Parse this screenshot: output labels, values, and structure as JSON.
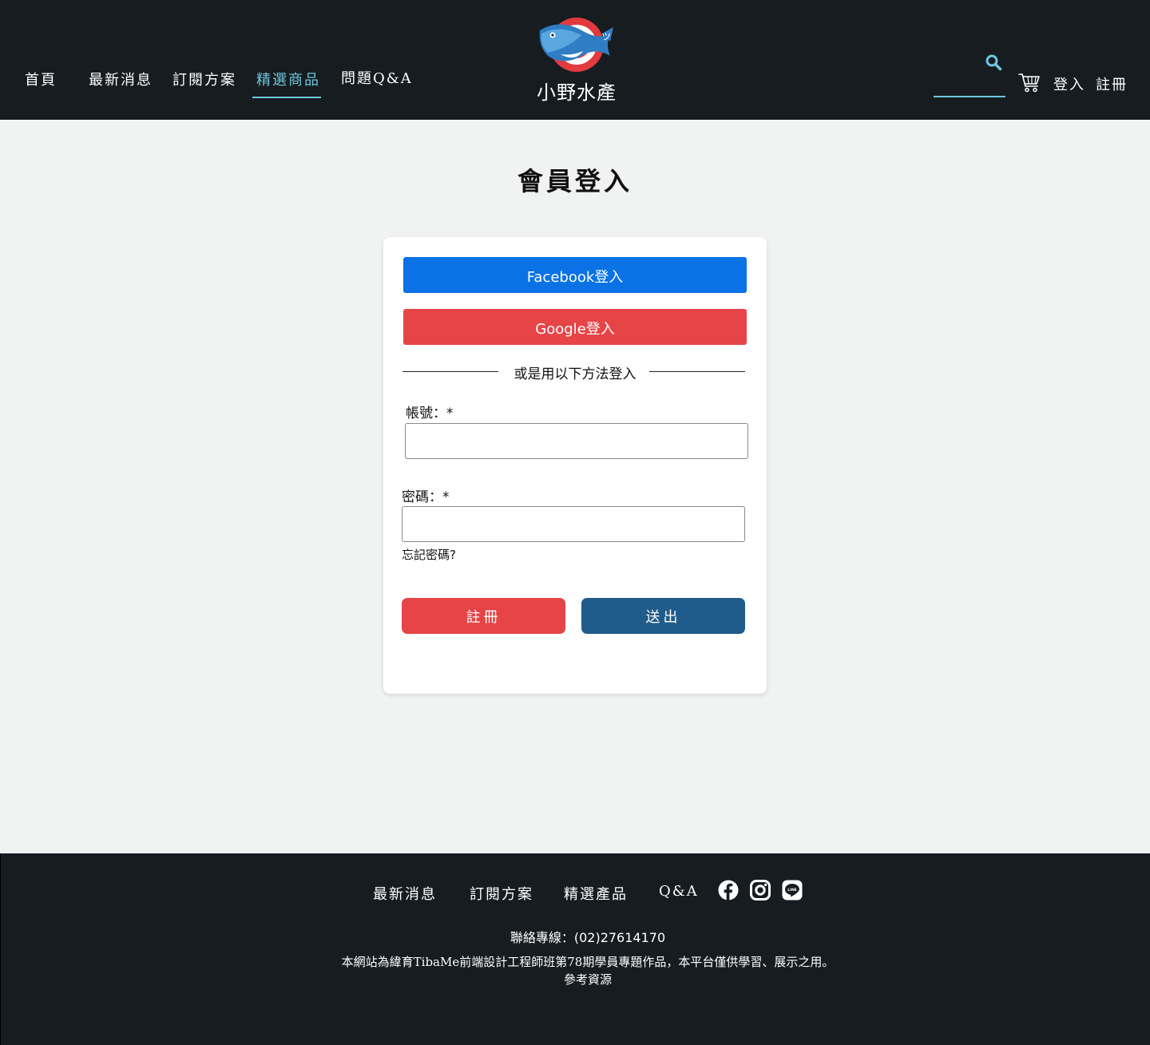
{
  "header": {
    "nav": [
      "首頁",
      "最新消息",
      "訂閱方案",
      "精選商品",
      "問題Q&A"
    ],
    "active_nav": "精選商品",
    "logo_text": "小野水產",
    "search": {
      "value": "",
      "placeholder": ""
    },
    "login_label": "登入",
    "register_label": "註冊",
    "icons": {
      "search": "search-icon",
      "cart": "cart-icon"
    }
  },
  "main": {
    "title": "會員登入",
    "facebook_label": "Facebook登入",
    "google_label": "Google登入",
    "divider_text": "或是用以下方法登入",
    "account_label": "帳號：*",
    "account": {
      "value": "",
      "placeholder": ""
    },
    "password_label": "密碼：*",
    "password": {
      "value": "",
      "placeholder": ""
    },
    "forgot_label": "忘記密碼?",
    "register_button": "註冊",
    "submit_button": "送出"
  },
  "footer": {
    "links": [
      "最新消息",
      "訂閱方案",
      "精選產品",
      "Q&A"
    ],
    "social_icons": [
      "facebook-icon",
      "instagram-icon",
      "line-icon"
    ],
    "contact": "聯絡專線：(02)27614170",
    "note": "本網站為緯育TibaMe前端設計工程師班第78期學員專題作品，本平台僅供學習、展示之用。",
    "reference": "參考資源"
  },
  "colors": {
    "header_bg": "#161c20",
    "page_bg": "#f1f3f2",
    "accent": "#6fc6dd",
    "facebook": "#0a72e5",
    "google": "#e64447",
    "submit": "#205c8b"
  }
}
